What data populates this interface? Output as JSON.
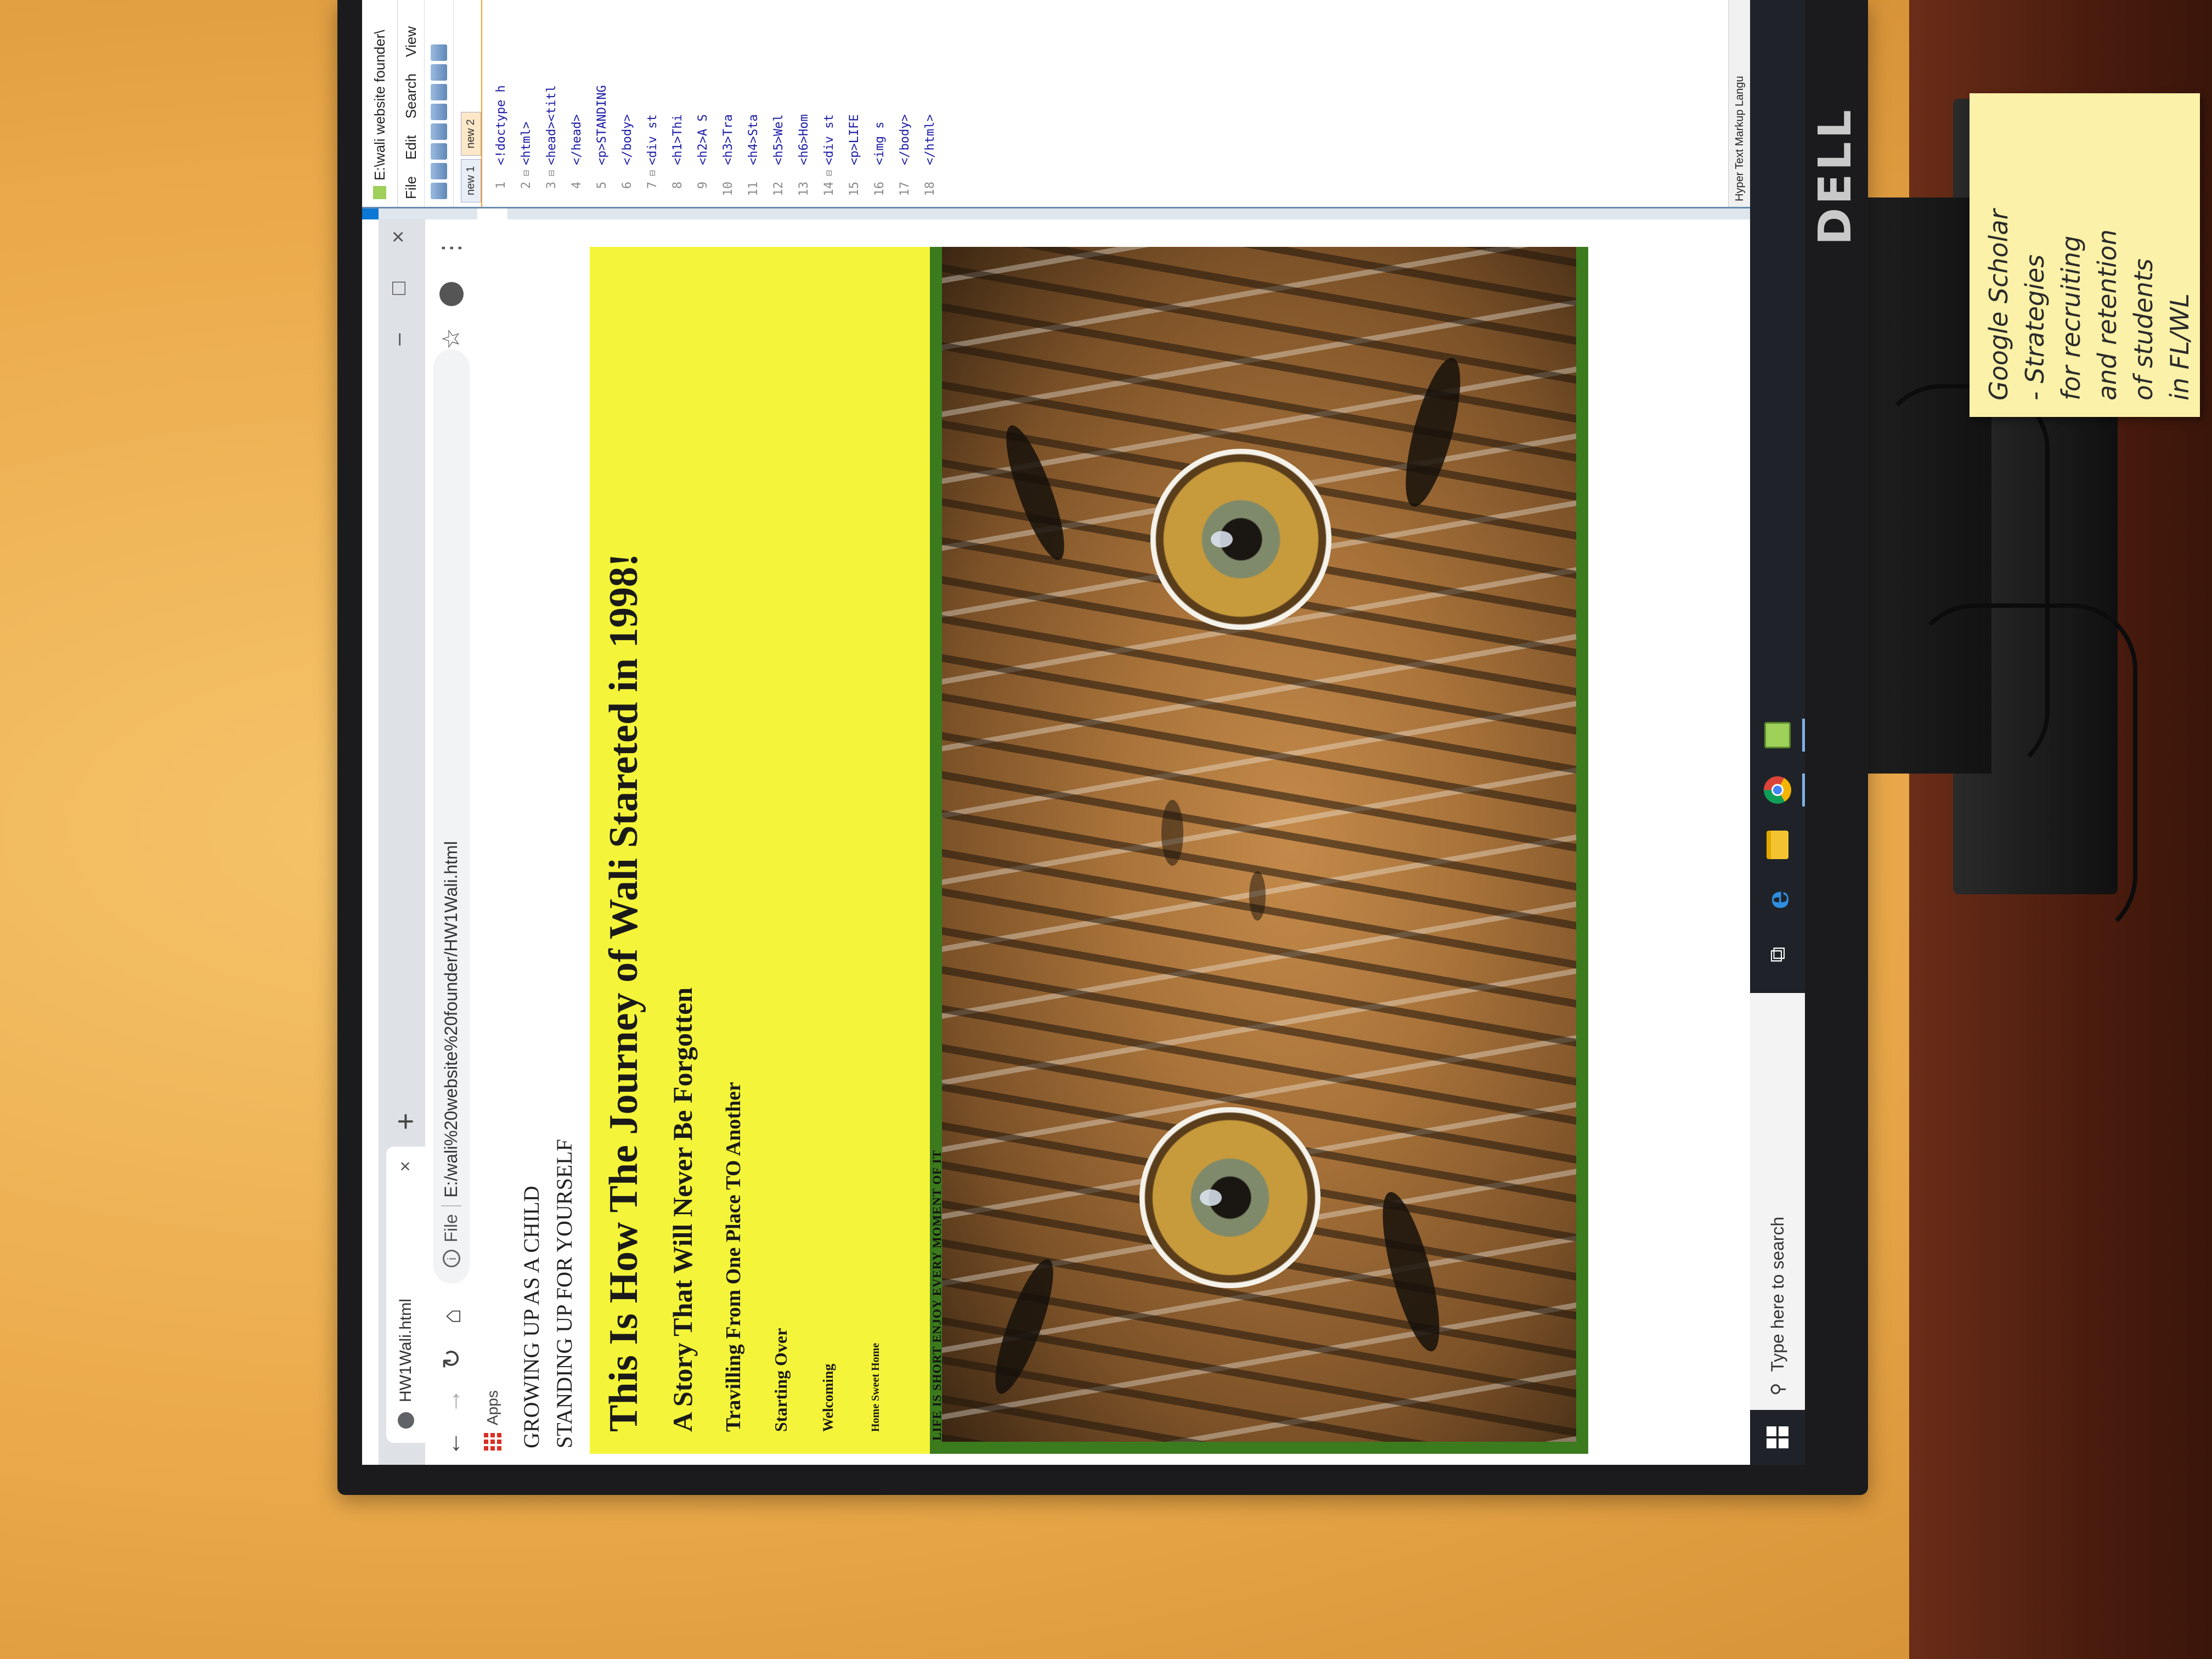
{
  "desktop": {
    "monitor_brand": "DELL"
  },
  "browser": {
    "tab_title": "HW1Wali.html",
    "tab_close": "×",
    "new_tab": "+",
    "window_controls": [
      "–",
      "□",
      "×"
    ],
    "address_scheme": "File",
    "address_url": "E:/wali%20website%20founder/HW1Wali.html",
    "bookmarks_apps_label": "Apps"
  },
  "page": {
    "lines": [
      "GROWING UP AS A CHILD",
      "STANDING UP FOR YOURSELF"
    ],
    "h1": "This Is How The Journey of Wali Stareted in 1998!",
    "h2": "A Story That Will Never Be Forgotten",
    "h3": "Travilling From One Place TO Another",
    "h4": "Starting Over",
    "h5": "Welcoming",
    "h6": "Home Sweet Home",
    "image_caption": "LIFE IS SHORT ENJOY EVERY MOMENT OF IT"
  },
  "notepadpp": {
    "title": "E:\\wali website founder\\",
    "menu": [
      "File",
      "Edit",
      "Search",
      "View"
    ],
    "tabs": [
      "new 1",
      "new 2"
    ],
    "lines": [
      {
        "n": "1",
        "code": "<!doctype h"
      },
      {
        "n": "2",
        "code": "<html>"
      },
      {
        "n": "3",
        "code": "<head><titl"
      },
      {
        "n": "4",
        "code": "</head>"
      },
      {
        "n": "5",
        "code": "<p>STANDING"
      },
      {
        "n": "6",
        "code": "</body>"
      },
      {
        "n": "7",
        "code": "<div st"
      },
      {
        "n": "8",
        "code": "<h1>Thi"
      },
      {
        "n": "9",
        "code": "<h2>A S"
      },
      {
        "n": "10",
        "code": "<h3>Tra"
      },
      {
        "n": "11",
        "code": "<h4>Sta"
      },
      {
        "n": "12",
        "code": "<h5>Wel"
      },
      {
        "n": "13",
        "code": "<h6>Hom"
      },
      {
        "n": "14",
        "code": "<div st"
      },
      {
        "n": "15",
        "code": "<p>LIFE"
      },
      {
        "n": "16",
        "code": "<img s"
      },
      {
        "n": "17",
        "code": "</body>"
      },
      {
        "n": "18",
        "code": "</html>"
      }
    ],
    "status": "Hyper Text Markup Langu"
  },
  "taskbar": {
    "search_placeholder": "Type here to search"
  },
  "sticky_note": {
    "lines": [
      "Google Scholar",
      "- Strategies",
      "for recruiting",
      "and retention",
      "of students",
      "in FL/WL"
    ]
  },
  "colors": {
    "page_banner": "#f4f53a",
    "image_frame": "#3c7a1e",
    "taskbar": "#1f2329",
    "window_accent": "#0a78d4"
  }
}
